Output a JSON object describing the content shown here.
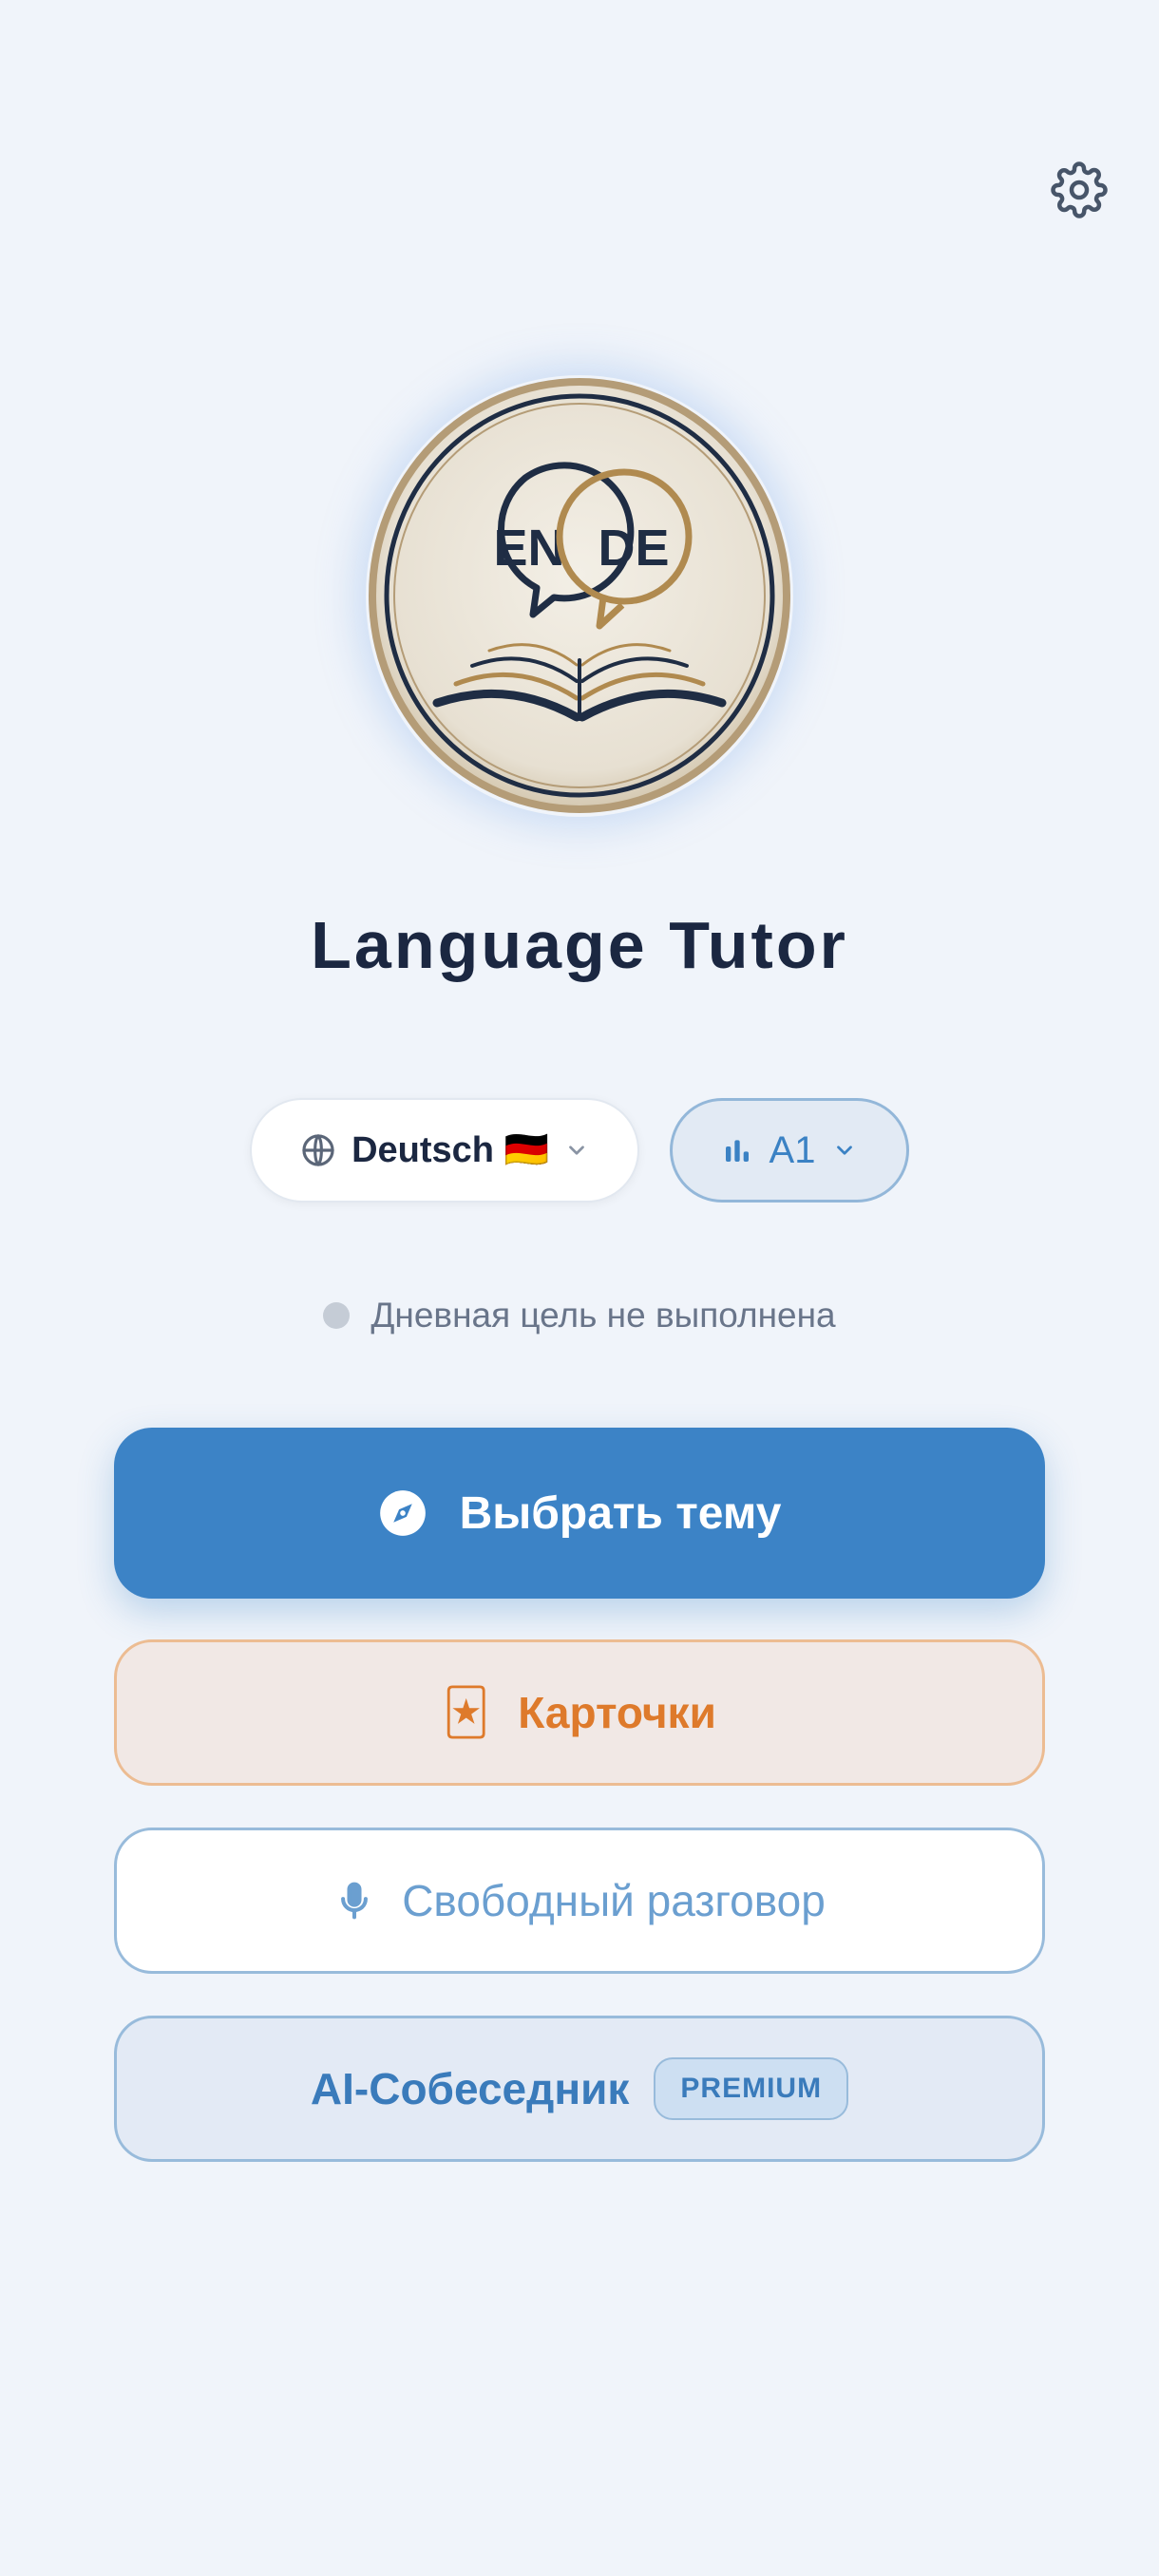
{
  "app": {
    "title": "Language Tutor"
  },
  "logo": {
    "left_label": "EN",
    "right_label": "DE"
  },
  "header": {
    "settings_icon": "gear-icon"
  },
  "language_select": {
    "label": "Deutsch 🇩🇪",
    "icon": "globe-icon"
  },
  "level_select": {
    "label": "A1",
    "icon": "bar-chart-icon"
  },
  "goal": {
    "status_text": "Дневная цель не выполнена"
  },
  "actions": {
    "choose_topic": {
      "label": "Выбрать тему",
      "icon": "compass-icon"
    },
    "cards": {
      "label": "Карточки",
      "icon": "🃏"
    },
    "free_talk": {
      "label": "Свободный разговор",
      "icon": "microphone-icon"
    },
    "ai_partner": {
      "label": "AI-Собеседник",
      "badge": "PREMIUM"
    }
  },
  "colors": {
    "background": "#f0f4fa",
    "primary": "#3c83c6",
    "cards_accent": "#de7a2b",
    "title": "#1b2741"
  }
}
